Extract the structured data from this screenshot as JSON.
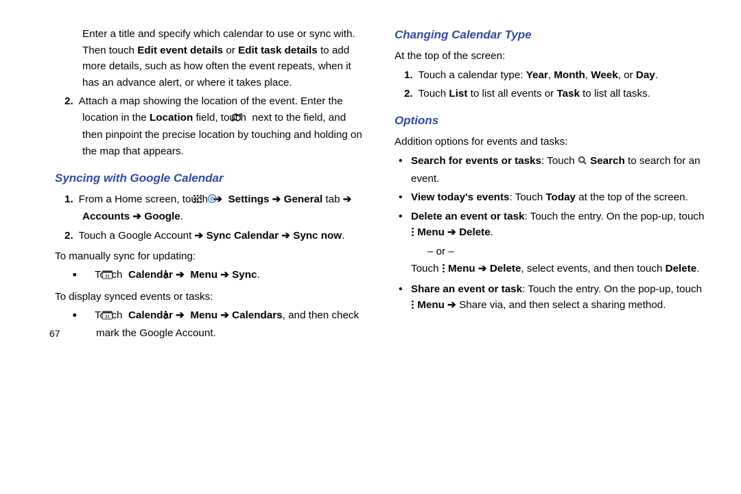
{
  "page_number": "67",
  "icons": {
    "map": "map-marker-icon",
    "apps": "app-grid-icon",
    "settings": "settings-gear-icon",
    "calendar": "calendar-31-icon",
    "menu": "kebab-menu-icon",
    "search": "search-icon"
  },
  "left": {
    "intro_para": {
      "pre": "Enter a title and specify which calendar to use or sync with. Then touch ",
      "b1": "Edit event details",
      "mid": " or ",
      "b2": "Edit task details",
      "post": " to add more details, such as how often the event repeats, when it has an advance alert, or where it takes place."
    },
    "item2": {
      "num": "2.",
      "t1": "Attach a map showing the location of the event. Enter the location in the ",
      "b1": "Location",
      "t2": " field, touch ",
      "t3": " next to the field, and then pinpoint the precise location by touching and holding on the map that appears."
    },
    "h_sync": "Syncing with Google Calendar",
    "sync1": {
      "num": "1.",
      "t1": "From a Home screen, touch ",
      "arrow1": " ➔ ",
      "b_settings": "Settings",
      "arrow2": " ➔ ",
      "b_general": "General",
      "t_tab": " tab ",
      "arrow3": "➔ ",
      "b_accounts": "Accounts",
      "arrow4": " ➔ ",
      "b_google": "Google",
      "dot": "."
    },
    "sync2": {
      "num": "2.",
      "t1": "Touch a Google Account ",
      "arrow1": "➔ ",
      "b_synccal": "Sync Calendar",
      "arrow2": " ➔ ",
      "b_syncnow": "Sync now",
      "dot": "."
    },
    "manual_label": "To manually sync for updating:",
    "manual_bullet": {
      "t1": "Touch ",
      "b_cal": "Calendar",
      "arrow1": " ➔ ",
      "b_menu": "Menu",
      "arrow2": " ➔ ",
      "b_sync": "Sync",
      "dot": "."
    },
    "display_label": "To display synced events or tasks:",
    "display_bullet": {
      "t1": "Touch ",
      "b_cal": "Calendar",
      "arrow1": " ➔ ",
      "b_menu": "Menu",
      "arrow2": " ➔ ",
      "b_cals": "Calendars",
      "t2": ", and then check mark the Google Account."
    }
  },
  "right": {
    "h_change": "Changing Calendar Type",
    "change_top": "At the top of the screen:",
    "c1": {
      "num": "1.",
      "t1": "Touch a calendar type: ",
      "b1": "Year",
      "c": ", ",
      "b2": "Month",
      "b3": "Week",
      "or": ", or ",
      "b4": "Day",
      "dot": "."
    },
    "c2": {
      "num": "2.",
      "t1": "Touch ",
      "b1": "List",
      "t2": " to list all events or ",
      "b2": "Task",
      "t3": " to list all tasks."
    },
    "h_options": "Options",
    "opt_intro": "Addition options for events and tasks:",
    "o_search": {
      "b1": "Search for events or tasks",
      "t1": ": Touch ",
      "b2": "Search",
      "t2": " to search for an event."
    },
    "o_today": {
      "b1": "View today's events",
      "t1": ": Touch ",
      "b2": "Today",
      "t2": " at the top of the screen."
    },
    "o_delete": {
      "b1": "Delete an event or task",
      "t1": ": Touch the entry. On the pop-up, touch ",
      "b_menu": "Menu",
      "arrow": " ➔ ",
      "b_delete": "Delete",
      "dot": "."
    },
    "o_or": "– or –",
    "o_delete2": {
      "t1": "Touch ",
      "b_menu": "Menu",
      "arrow": " ➔ ",
      "b_delete": "Delete",
      "t2": ", select events, and then touch ",
      "b_delete2": "Delete",
      "dot": "."
    },
    "o_share": {
      "b1": "Share an event or task",
      "t1": ": Touch the entry. On the pop-up, touch ",
      "b_menu": "Menu",
      "arrow": " ➔ ",
      "t2": "Share via, and then select a sharing method."
    }
  }
}
